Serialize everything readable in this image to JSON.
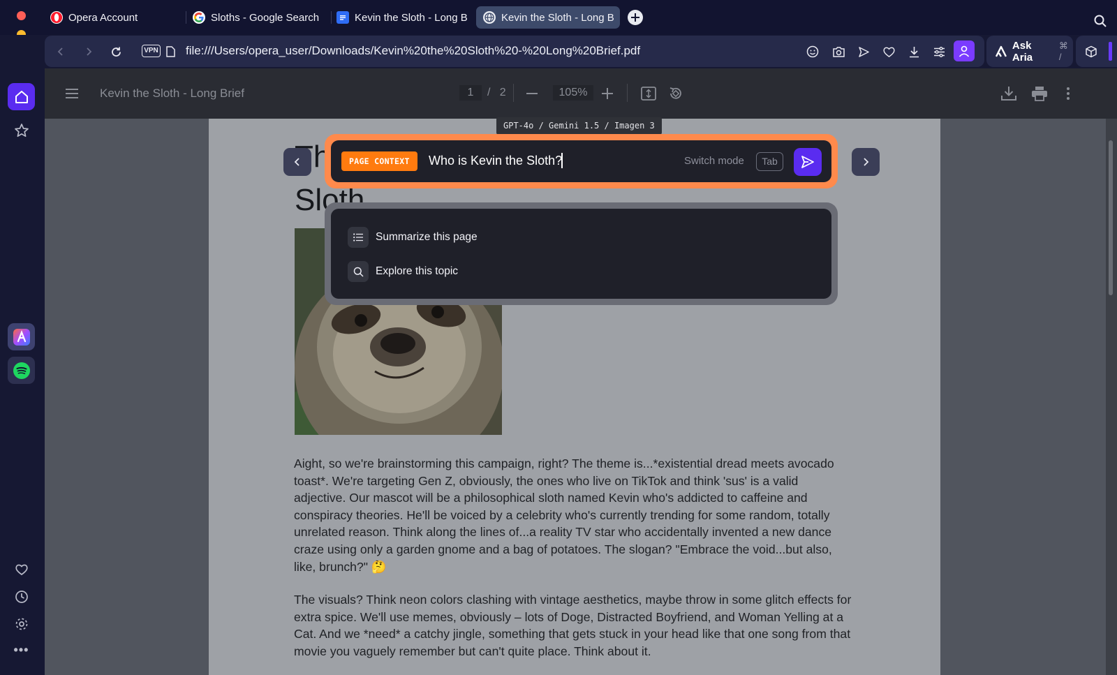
{
  "tabs": [
    {
      "label": "Opera Account",
      "icon": "opera-icon"
    },
    {
      "label": "Sloths - Google Search",
      "icon": "google-icon"
    },
    {
      "label": "Kevin the Sloth - Long B",
      "icon": "docs-icon"
    },
    {
      "label": "Kevin the Sloth - Long B",
      "icon": "globe-icon",
      "active": true
    }
  ],
  "address_bar": {
    "vpn_label": "VPN",
    "url": "file:///Users/opera_user/Downloads/Kevin%20the%20Sloth%20-%20Long%20Brief.pdf"
  },
  "aria_button": {
    "label": "Ask Aria",
    "shortcut": "⌘ /"
  },
  "pdf_viewer": {
    "title": "Kevin the Sloth - Long Brief",
    "current_page": "1",
    "page_separator": "/",
    "total_pages": "2",
    "zoom": "105%"
  },
  "document": {
    "title_line1": "Th",
    "title_line2": "Sloth",
    "paragraphs": [
      "Aight, so we're brainstorming this campaign, right?  The theme is...*existential dread meets avocado toast*.  We're targeting Gen Z, obviously, the ones who live on TikTok and think 'sus' is a valid adjective.  Our mascot will be a philosophical sloth named Kevin who's addicted to caffeine and conspiracy theories.  He'll be voiced by a celebrity who's currently trending for some random, totally unrelated reason.  Think along the lines of...a reality TV star who accidentally invented a new dance craze using only a garden gnome and a bag of potatoes.  The slogan?  \"Embrace the void...but also, like, brunch?\" 🤔",
      "The visuals? Think neon colors clashing with vintage aesthetics, maybe throw in some glitch effects for extra spice.  We'll use memes, obviously – lots of Doge, Distracted Boyfriend, and Woman Yelling at a Cat.  And we *need* a catchy jingle, something that gets stuck in your head like that one song from that movie you vaguely remember but can't quite place.  Think about it."
    ]
  },
  "aria": {
    "model_tag": "GPT-4o / Gemini 1.5 / Imagen 3",
    "context_badge": "PAGE CONTEXT",
    "prompt_value": "Who is Kevin the Sloth?",
    "switch_mode_label": "Switch mode",
    "tab_key": "Tab",
    "suggestions": [
      {
        "label": "Summarize this page",
        "icon": "list-icon"
      },
      {
        "label": "Explore this topic",
        "icon": "search-icon"
      }
    ]
  },
  "colors": {
    "accent_purple": "#5a2cf0",
    "page_context_orange": "#ff7b0f",
    "prompt_border": "#ff8a4c"
  }
}
